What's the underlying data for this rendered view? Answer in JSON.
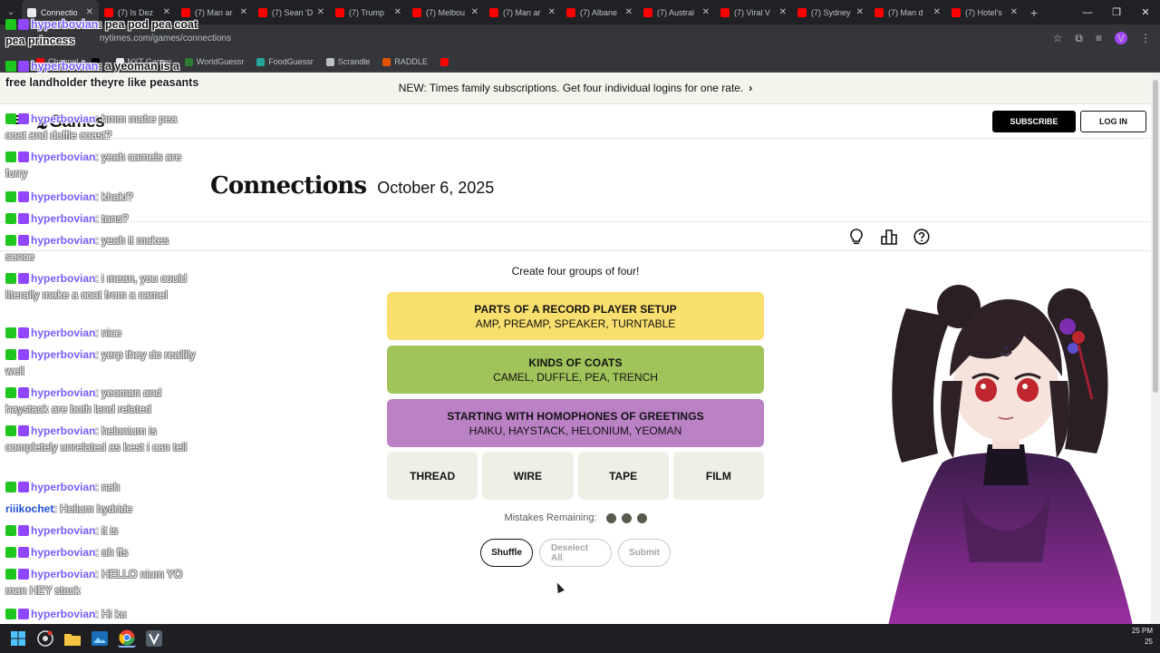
{
  "browser": {
    "tabs": [
      {
        "title": "Connectio",
        "active": true,
        "favicon": "nyt-icon"
      },
      {
        "title": "(7) Is Dez",
        "favicon": "youtube-icon"
      },
      {
        "title": "(7) Man ar",
        "favicon": "youtube-icon"
      },
      {
        "title": "(7) Sean 'D",
        "favicon": "youtube-icon"
      },
      {
        "title": "(7) Trump",
        "favicon": "youtube-icon"
      },
      {
        "title": "(7) Melbou",
        "favicon": "youtube-icon"
      },
      {
        "title": "(7) Man ar",
        "favicon": "youtube-icon"
      },
      {
        "title": "(7) Albane",
        "favicon": "youtube-icon"
      },
      {
        "title": "(7) Austral",
        "favicon": "youtube-icon"
      },
      {
        "title": "(7) Viral V",
        "favicon": "youtube-icon"
      },
      {
        "title": "(7) Sydney",
        "favicon": "youtube-icon"
      },
      {
        "title": "(7) Man d",
        "favicon": "youtube-icon"
      },
      {
        "title": "(7) Hotel's",
        "favicon": "youtube-icon"
      }
    ],
    "url": "nytimes.com/games/connections",
    "profile_initial": "V",
    "bookmarks": [
      {
        "label": "Channel",
        "icon": "youtube-icon"
      },
      {
        "label": "",
        "icon": "x-icon"
      },
      {
        "label": "NYT Games",
        "icon": "nyt-icon"
      },
      {
        "label": "WorldGuessr",
        "icon": "globe-icon"
      },
      {
        "label": "FoodGuessr",
        "icon": "food-icon"
      },
      {
        "label": "Scrandle",
        "icon": "scrandle-icon"
      },
      {
        "label": "RADDLE",
        "icon": "raddle-icon"
      },
      {
        "label": "",
        "icon": "youtube-icon"
      }
    ]
  },
  "site": {
    "promo": "NEW: Times family subscriptions. Get four individual logins for one rate.",
    "promo_arrow": "›",
    "logo_glyph": "𝕿",
    "logo_text": "Games",
    "subscribe": "SUBSCRIBE",
    "login": "LOG IN"
  },
  "game": {
    "title": "Connections",
    "date": "October 6, 2025",
    "prompt": "Create four groups of four!",
    "groups": [
      {
        "name": "PARTS OF A RECORD PLAYER SETUP",
        "words": "AMP, PREAMP, SPEAKER, TURNTABLE",
        "color": "#f9df6d"
      },
      {
        "name": "KINDS OF COATS",
        "words": "CAMEL, DUFFLE, PEA, TRENCH",
        "color": "#a0c35a"
      },
      {
        "name": "STARTING WITH HOMOPHONES OF GREETINGS",
        "words": "HAIKU, HAYSTACK, HELONIUM, YEOMAN",
        "color": "#ba81c5"
      }
    ],
    "tiles": [
      "THREAD",
      "WIRE",
      "TAPE",
      "FILM"
    ],
    "mistakes_label": "Mistakes Remaining:",
    "mistakes_remaining": 3,
    "buttons": {
      "shuffle": "Shuffle",
      "deselect": "Deselect All",
      "submit": "Submit"
    }
  },
  "chat": [
    {
      "user": "hyperbovian",
      "text": "pea pod pea coat pea princess",
      "style": "dark"
    },
    {
      "user": "hyperbovian",
      "text": "a yeoman is a free landholder theyre like peasants",
      "style": "dark"
    },
    {
      "user": "hyperbovian",
      "text": "hmm mabe pea coat and duffle coast?"
    },
    {
      "user": "hyperbovian",
      "text": "yeah camels are furry"
    },
    {
      "user": "hyperbovian",
      "text": "khaki?"
    },
    {
      "user": "hyperbovian",
      "text": "tans?"
    },
    {
      "user": "hyperbovian",
      "text": "yeah it makes sence"
    },
    {
      "user": "hyperbovian",
      "text": "i mean, you could literally make a coat from a camel"
    },
    {
      "user": "hyperbovian",
      "text": "nice"
    },
    {
      "user": "hyperbovian",
      "text": "yerp they do realllly well"
    },
    {
      "user": "hyperbovian",
      "text": "yeoman and haystack are both land related"
    },
    {
      "user": "hyperbovian",
      "text": "helonium is completely unrelated as best i can tell"
    },
    {
      "user": "hyperbovian",
      "text": "nah"
    },
    {
      "user": "riiikochet",
      "text": "Helium hydride",
      "style": "nobadge"
    },
    {
      "user": "hyperbovian",
      "text": "it is"
    },
    {
      "user": "hyperbovian",
      "text": "oh ffs"
    },
    {
      "user": "hyperbovian",
      "text": "HELLO nium YO man HEY stack"
    },
    {
      "user": "hyperbovian",
      "text": "Hi ku"
    }
  ],
  "taskbar": {
    "clock_time": "25 PM",
    "clock_date": "25"
  }
}
